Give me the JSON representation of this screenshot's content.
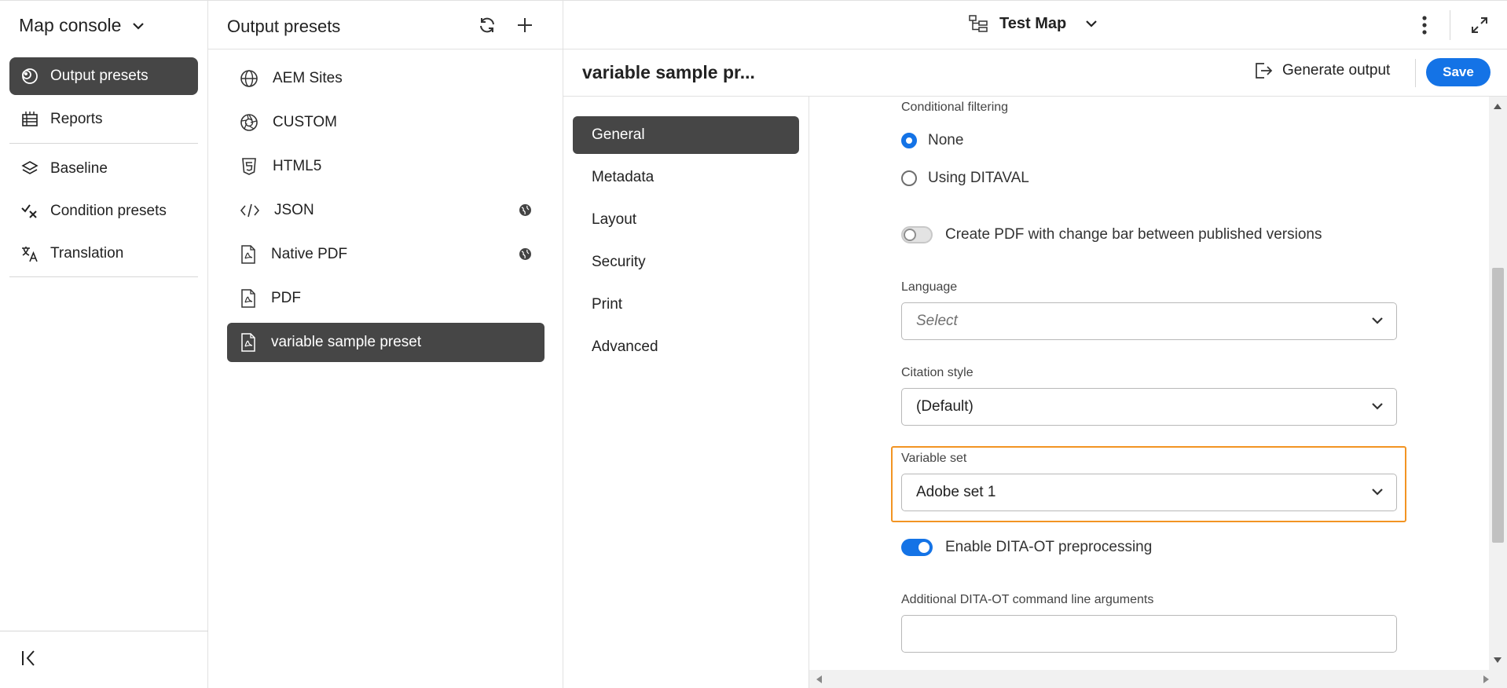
{
  "sidebar": {
    "title": "Map console",
    "items": [
      {
        "label": "Output presets",
        "icon": "output-presets-icon",
        "active": true
      },
      {
        "label": "Reports",
        "icon": "reports-icon"
      },
      {
        "label": "Baseline",
        "icon": "baseline-icon"
      },
      {
        "label": "Condition presets",
        "icon": "condition-presets-icon"
      },
      {
        "label": "Translation",
        "icon": "translation-icon"
      }
    ]
  },
  "presets": {
    "title": "Output presets",
    "items": [
      {
        "label": "AEM Sites",
        "icon": "globe-icon"
      },
      {
        "label": "CUSTOM",
        "icon": "aperture-icon"
      },
      {
        "label": "HTML5",
        "icon": "html5-icon"
      },
      {
        "label": "JSON",
        "icon": "code-icon",
        "badge": "globe-badge-icon"
      },
      {
        "label": "Native PDF",
        "icon": "pdf-file-icon",
        "badge": "globe-badge-icon"
      },
      {
        "label": "PDF",
        "icon": "pdf-file-icon"
      },
      {
        "label": "variable sample preset",
        "icon": "pdf-file-icon",
        "active": true
      }
    ]
  },
  "header": {
    "map_name": "Test Map",
    "preset_title": "variable sample pr...",
    "generate_label": "Generate output",
    "save_label": "Save"
  },
  "tabs": [
    {
      "label": "General",
      "active": true
    },
    {
      "label": "Metadata"
    },
    {
      "label": "Layout"
    },
    {
      "label": "Security"
    },
    {
      "label": "Print"
    },
    {
      "label": "Advanced"
    }
  ],
  "form": {
    "conditional_filtering": {
      "label": "Conditional filtering",
      "options": [
        "None",
        "Using DITAVAL"
      ],
      "selected": "None"
    },
    "change_bar": {
      "label": "Create PDF with change bar between published versions",
      "on": false
    },
    "language": {
      "label": "Language",
      "placeholder": "Select"
    },
    "citation": {
      "label": "Citation style",
      "value": "(Default)"
    },
    "variable_set": {
      "label": "Variable set",
      "value": "Adobe set 1"
    },
    "dita_ot": {
      "label": "Enable DITA-OT preprocessing",
      "on": true
    },
    "dita_args": {
      "label": "Additional DITA-OT command line arguments",
      "value": ""
    }
  },
  "colors": {
    "accent": "#1473e6",
    "highlight": "#f29423",
    "active_bg": "#464646"
  }
}
